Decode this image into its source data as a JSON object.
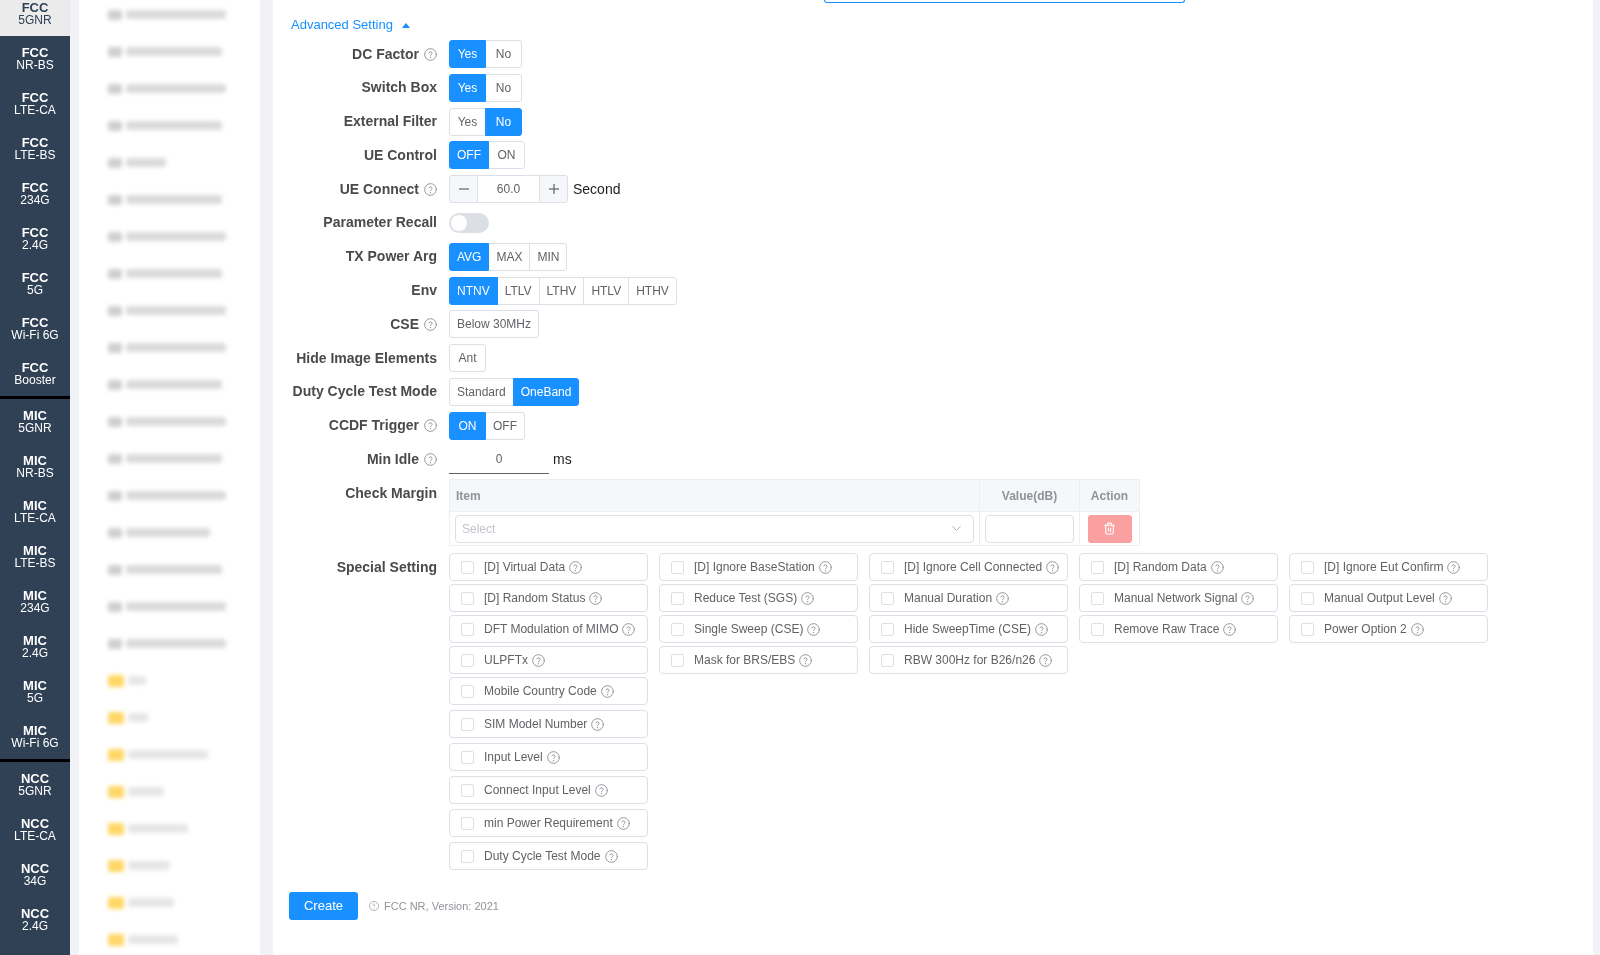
{
  "sidebar": {
    "groups": [
      {
        "items": [
          {
            "title": "FCC",
            "subtitle": "5GNR",
            "selected": true
          },
          {
            "title": "FCC",
            "subtitle": "NR-BS",
            "selected": false
          },
          {
            "title": "FCC",
            "subtitle": "LTE-CA",
            "selected": false
          },
          {
            "title": "FCC",
            "subtitle": "LTE-BS",
            "selected": false
          },
          {
            "title": "FCC",
            "subtitle": "234G",
            "selected": false
          },
          {
            "title": "FCC",
            "subtitle": "2.4G",
            "selected": false
          },
          {
            "title": "FCC",
            "subtitle": "5G",
            "selected": false
          },
          {
            "title": "FCC",
            "subtitle": "Wi-Fi 6G",
            "selected": false
          },
          {
            "title": "FCC",
            "subtitle": "Booster",
            "selected": false
          }
        ]
      },
      {
        "items": [
          {
            "title": "MIC",
            "subtitle": "5GNR",
            "selected": false
          },
          {
            "title": "MIC",
            "subtitle": "NR-BS",
            "selected": false
          },
          {
            "title": "MIC",
            "subtitle": "LTE-CA",
            "selected": false
          },
          {
            "title": "MIC",
            "subtitle": "LTE-BS",
            "selected": false
          },
          {
            "title": "MIC",
            "subtitle": "234G",
            "selected": false
          },
          {
            "title": "MIC",
            "subtitle": "2.4G",
            "selected": false
          },
          {
            "title": "MIC",
            "subtitle": "5G",
            "selected": false
          },
          {
            "title": "MIC",
            "subtitle": "Wi-Fi 6G",
            "selected": false
          }
        ]
      },
      {
        "items": [
          {
            "title": "NCC",
            "subtitle": "5GNR",
            "selected": false
          },
          {
            "title": "NCC",
            "subtitle": "LTE-CA",
            "selected": false
          },
          {
            "title": "NCC",
            "subtitle": "34G",
            "selected": false
          },
          {
            "title": "NCC",
            "subtitle": "2.4G",
            "selected": false
          }
        ]
      }
    ]
  },
  "file_list": {
    "items": [
      {
        "kind": "file"
      },
      {
        "kind": "file"
      },
      {
        "kind": "file"
      },
      {
        "kind": "file"
      },
      {
        "kind": "file"
      },
      {
        "kind": "file"
      },
      {
        "kind": "file"
      },
      {
        "kind": "file"
      },
      {
        "kind": "file"
      },
      {
        "kind": "file"
      },
      {
        "kind": "file"
      },
      {
        "kind": "file"
      },
      {
        "kind": "file"
      },
      {
        "kind": "file"
      },
      {
        "kind": "file"
      },
      {
        "kind": "file"
      },
      {
        "kind": "file"
      },
      {
        "kind": "file"
      },
      {
        "kind": "folder"
      },
      {
        "kind": "folder"
      },
      {
        "kind": "folder"
      },
      {
        "kind": "folder"
      },
      {
        "kind": "folder"
      },
      {
        "kind": "folder"
      },
      {
        "kind": "folder"
      },
      {
        "kind": "folder"
      }
    ]
  },
  "advanced_setting": {
    "label": "Advanced Setting",
    "expanded": true
  },
  "form": {
    "rows": [
      {
        "kind": "radio",
        "label": "DC Factor",
        "help": true,
        "options": [
          {
            "label": "Yes",
            "selected": true
          },
          {
            "label": "No",
            "selected": false
          }
        ]
      },
      {
        "kind": "radio",
        "label": "Switch Box",
        "help": false,
        "options": [
          {
            "label": "Yes",
            "selected": true
          },
          {
            "label": "No",
            "selected": false
          }
        ]
      },
      {
        "kind": "radio",
        "label": "External Filter",
        "help": false,
        "options": [
          {
            "label": "Yes",
            "selected": false
          },
          {
            "label": "No",
            "selected": true
          }
        ]
      },
      {
        "kind": "radio",
        "label": "UE Control",
        "help": false,
        "options": [
          {
            "label": "OFF",
            "selected": true
          },
          {
            "label": "ON",
            "selected": false
          }
        ]
      },
      {
        "kind": "stepper",
        "label": "UE Connect",
        "help": true,
        "value": "60.0",
        "unit": "Second"
      },
      {
        "kind": "switch",
        "label": "Parameter Recall",
        "help": false,
        "on": false
      },
      {
        "kind": "radio",
        "label": "TX Power Arg",
        "help": false,
        "options": [
          {
            "label": "AVG",
            "selected": true
          },
          {
            "label": "MAX",
            "selected": false
          },
          {
            "label": "MIN",
            "selected": false
          }
        ]
      },
      {
        "kind": "radio",
        "label": "Env",
        "help": false,
        "options": [
          {
            "label": "NTNV",
            "selected": true
          },
          {
            "label": "LTLV",
            "selected": false
          },
          {
            "label": "LTHV",
            "selected": false
          },
          {
            "label": "HTLV",
            "selected": false
          },
          {
            "label": "HTHV",
            "selected": false
          }
        ]
      },
      {
        "kind": "radio",
        "label": "CSE",
        "help": true,
        "options": [
          {
            "label": "Below 30MHz",
            "selected": false
          }
        ]
      },
      {
        "kind": "radio",
        "label": "Hide Image Elements",
        "help": false,
        "options": [
          {
            "label": "Ant",
            "selected": false
          }
        ]
      },
      {
        "kind": "radio",
        "label": "Duty Cycle Test Mode",
        "help": false,
        "options": [
          {
            "label": "Standard",
            "selected": false
          },
          {
            "label": "OneBand",
            "selected": true
          }
        ]
      },
      {
        "kind": "radio",
        "label": "CCDF Trigger",
        "help": true,
        "options": [
          {
            "label": "ON",
            "selected": true
          },
          {
            "label": "OFF",
            "selected": false
          }
        ]
      },
      {
        "kind": "underline_input",
        "label": "Min Idle",
        "help": true,
        "value": "0",
        "unit": "ms"
      },
      {
        "kind": "table",
        "label": "Check Margin",
        "help": false,
        "columns": [
          "Item",
          "Value(dB)",
          "Action"
        ],
        "rows": [
          {
            "item_placeholder": "Select",
            "delete_disabled": true
          }
        ]
      },
      {
        "kind": "checkboxes",
        "label": "Special Setting",
        "help": false,
        "groups": [
          {
            "kind": "grid",
            "options": [
              {
                "label": "[D] Virtual Data",
                "checked": false,
                "help": true
              },
              {
                "label": "[D] Ignore BaseStation",
                "checked": false,
                "help": true
              },
              {
                "label": "[D] Ignore Cell Connected",
                "checked": false,
                "help": true
              },
              {
                "label": "[D] Random Data",
                "checked": false,
                "help": true
              },
              {
                "label": "[D] Ignore Eut Confirm",
                "checked": false,
                "help": true
              },
              {
                "label": "[D] Random Status",
                "checked": false,
                "help": true
              },
              {
                "label": "Reduce Test (SGS)",
                "checked": false,
                "help": true
              },
              {
                "label": "Manual Duration",
                "checked": false,
                "help": true
              },
              {
                "label": "Manual Network Signal",
                "checked": false,
                "help": true
              },
              {
                "label": "Manual Output Level",
                "checked": false,
                "help": true
              },
              {
                "label": "DFT Modulation of MIMO",
                "checked": false,
                "help": true
              },
              {
                "label": "Single Sweep (CSE)",
                "checked": false,
                "help": true
              },
              {
                "label": "Hide SweepTime (CSE)",
                "checked": false,
                "help": true
              },
              {
                "label": "Remove Raw Trace",
                "checked": false,
                "help": true
              },
              {
                "label": "Power Option 2",
                "checked": false,
                "help": true
              },
              {
                "label": "ULPFTx",
                "checked": false,
                "help": true
              },
              {
                "label": "Mask for BRS/EBS",
                "checked": false,
                "help": true
              },
              {
                "label": "RBW 300Hz for B26/n26",
                "checked": false,
                "help": true
              }
            ]
          },
          {
            "kind": "column",
            "options": [
              {
                "label": "Mobile Country Code",
                "checked": false,
                "help": true
              },
              {
                "label": "SIM Model Number",
                "checked": false,
                "help": true
              },
              {
                "label": "Input Level",
                "checked": false,
                "help": true
              },
              {
                "label": "Connect Input Level",
                "checked": false,
                "help": true
              },
              {
                "label": "min Power Requirement",
                "checked": false,
                "help": true
              },
              {
                "label": "Duty Cycle Test Mode",
                "checked": false,
                "help": true
              }
            ]
          }
        ]
      }
    ]
  },
  "footer": {
    "button": "Create",
    "note": "FCC NR, Version: 2021"
  }
}
